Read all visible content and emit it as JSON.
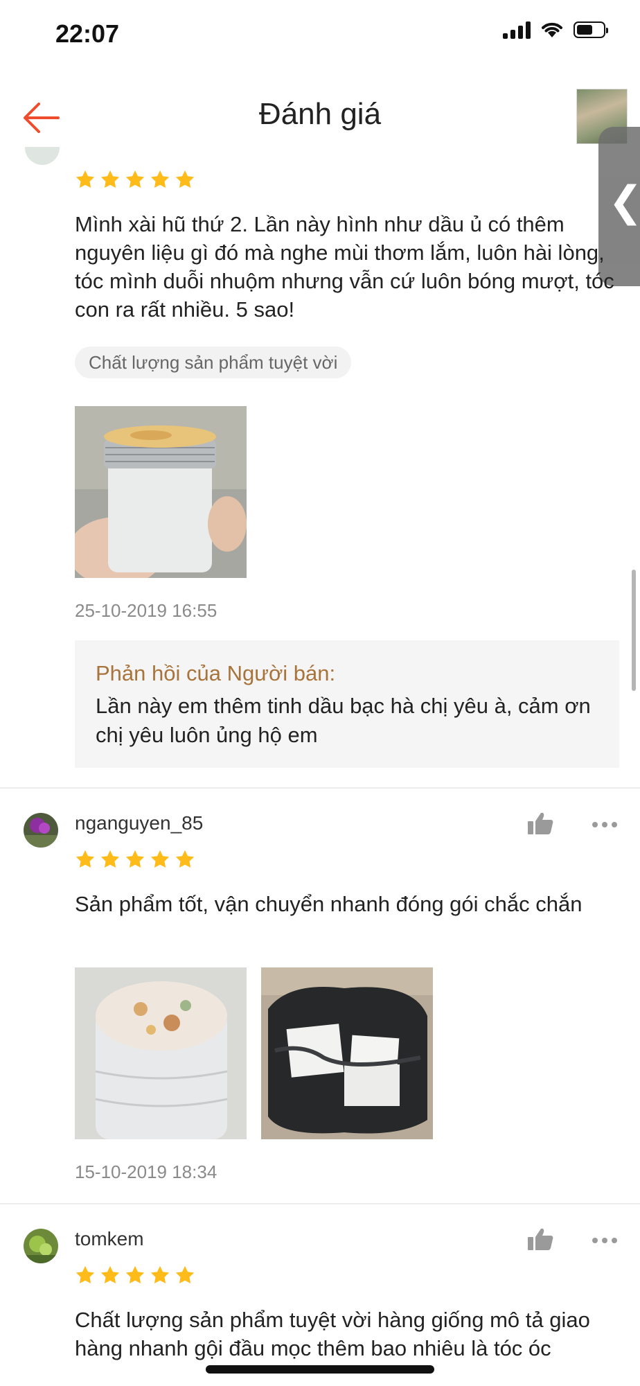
{
  "status_bar": {
    "time": "22:07"
  },
  "header": {
    "title": "Đánh giá"
  },
  "reviews": [
    {
      "stars": 5,
      "text": "Mình xài hũ thứ 2. Lần này hình như dầu ủ có thêm nguyên liệu gì đó mà nghe mùi thơm lắm, luôn hài lòng, tóc mình duỗi nhuộm nhưng vẫn cứ luôn bóng mượt, tóc con ra rất nhiều. 5 sao!",
      "tag": "Chất lượng sản phẩm tuyệt vời",
      "date": "25-10-2019 16:55",
      "seller_reply": {
        "label": "Phản hồi của Người bán:",
        "text": "Lần này em thêm tinh dầu bạc hà chị yêu à, cảm ơn chị yêu luôn ủng hộ em"
      }
    },
    {
      "username": "nganguyen_85",
      "stars": 5,
      "text": "Sản phẩm tốt, vận chuyển nhanh đóng gói chắc chắn",
      "date": "15-10-2019 18:34"
    },
    {
      "username": "tomkem",
      "stars": 5,
      "text": "Chất lượng sản phẩm tuyệt vời hàng giống mô tả giao hàng nhanh gội đầu mọc thêm bao nhiêu là tóc óc"
    }
  ],
  "colors": {
    "accent": "#ee4d2d",
    "star": "#ffbb1a",
    "seller_label": "#a8743c"
  }
}
